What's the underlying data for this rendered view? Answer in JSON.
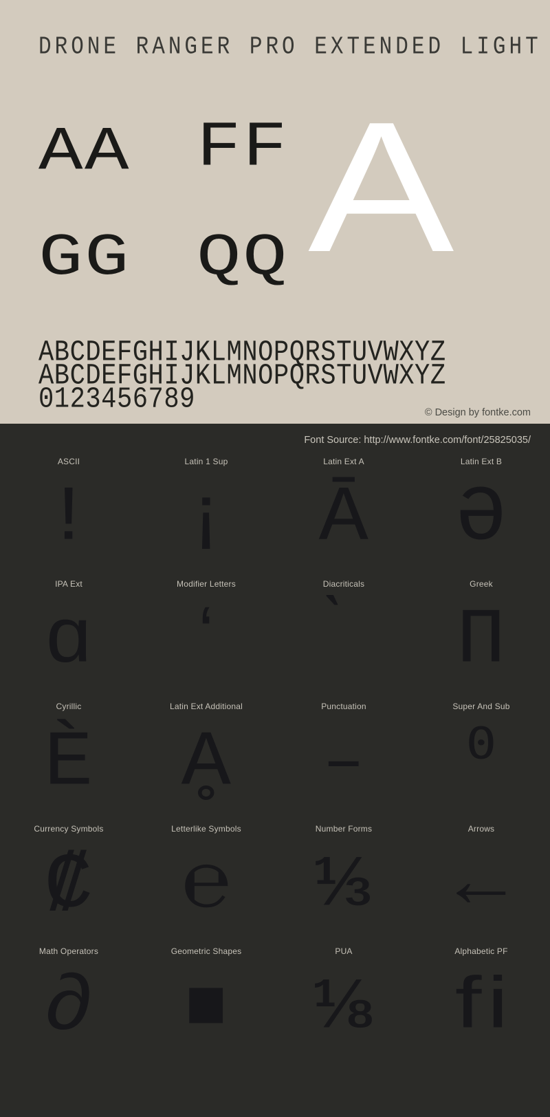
{
  "specimen": {
    "title": "DRONE RANGER PRO EXTENDED LIGHT",
    "copyright": "© Design by fontke.com",
    "font_source": "Font Source: http://www.fontke.com/font/25825035/",
    "colors": {
      "top_background": "#d3cbbe",
      "bottom_background": "#2b2b28",
      "glyph_dark": "#17171a",
      "big_letter": "#ffffff",
      "label_text": "#c6c2b8"
    },
    "samples": [
      {
        "name": "sample-aa",
        "text": "AA"
      },
      {
        "name": "sample-ff",
        "text": "FF"
      },
      {
        "name": "sample-gg",
        "text": "GG"
      },
      {
        "name": "sample-qq",
        "text": "QQ"
      }
    ],
    "big_letter": "A",
    "alphabet_rows": [
      "ABCDEFGHIJKLMNOPQRSTUVWXYZ",
      "ABCDEFGHIJKLMNOPQRSTUVWXYZ",
      "0123456789"
    ]
  },
  "unicode_blocks": [
    {
      "label": "ASCII",
      "glyph": "!"
    },
    {
      "label": "Latin 1 Sup",
      "glyph": "¡"
    },
    {
      "label": "Latin Ext A",
      "glyph": "Ā"
    },
    {
      "label": "Latin Ext B",
      "glyph": "Ə"
    },
    {
      "label": "IPA Ext",
      "glyph": "ɑ"
    },
    {
      "label": "Modifier Letters",
      "glyph": "ʻ"
    },
    {
      "label": "Diacriticals",
      "glyph": "̀"
    },
    {
      "label": "Greek",
      "glyph": "Π"
    },
    {
      "label": "Cyrillic",
      "glyph": "Ѐ"
    },
    {
      "label": "Latin Ext Additional",
      "glyph": "Ḁ"
    },
    {
      "label": "Punctuation",
      "glyph": "‒"
    },
    {
      "label": "Super And Sub",
      "glyph": "⁰"
    },
    {
      "label": "Currency Symbols",
      "glyph": "₡"
    },
    {
      "label": "Letterlike Symbols",
      "glyph": "℮"
    },
    {
      "label": "Number Forms",
      "glyph": "⅓"
    },
    {
      "label": "Arrows",
      "glyph": "←"
    },
    {
      "label": "Math Operators",
      "glyph": "∂"
    },
    {
      "label": "Geometric Shapes",
      "glyph": "■"
    },
    {
      "label": "PUA",
      "glyph": "⅛"
    },
    {
      "label": "Alphabetic PF",
      "glyph": "ﬁ"
    }
  ]
}
